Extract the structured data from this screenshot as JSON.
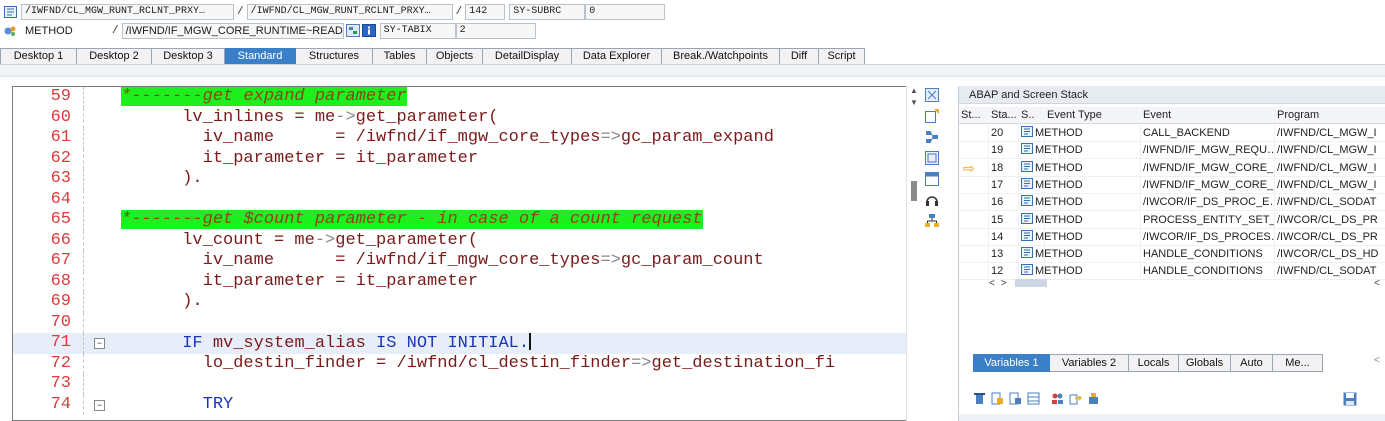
{
  "header": {
    "row1": {
      "icon": "program-icon",
      "main_program": "/IWFND/CL_MGW_RUNT_RCLNT_PRXY…",
      "include": "/IWFND/CL_MGW_RUNT_RCLNT_PRXY…",
      "line": "142",
      "sysvar_name": "SY-SUBRC",
      "sysvar_value": "0"
    },
    "row2": {
      "icon": "method-icon",
      "event_type": "METHOD",
      "event": "/IWFND/IF_MGW_CORE_RUNTIME~READ_ENTITYSET (…",
      "sysvar_name": "SY-TABIX",
      "sysvar_value": "2"
    }
  },
  "tabs": [
    "Desktop 1",
    "Desktop 2",
    "Desktop 3",
    "Standard",
    "Structures",
    "Tables",
    "Objects",
    "DetailDisplay",
    "Data Explorer",
    "Break./Watchpoints",
    "Diff",
    "Script"
  ],
  "active_tab": "Standard",
  "editor": {
    "lines": [
      {
        "n": "59",
        "a": "",
        "b": "*-------get expand parameter",
        "c": "",
        "kind": "comment"
      },
      {
        "n": "60",
        "a": "      lv_inlines = me",
        "b": "->",
        "c": "get_parameter(",
        "kind": "arrow"
      },
      {
        "n": "61",
        "a": "        iv_name      = /iwfnd/if_mgw_core_types",
        "b": "=>",
        "c": "gc_param_expand",
        "kind": "arrow"
      },
      {
        "n": "62",
        "a": "        it_parameter = it_parameter",
        "b": "",
        "c": "",
        "kind": "plain"
      },
      {
        "n": "63",
        "a": "      ).",
        "b": "",
        "c": "",
        "kind": "plain"
      },
      {
        "n": "64",
        "a": "",
        "b": "",
        "c": "",
        "kind": "plain"
      },
      {
        "n": "65",
        "a": "",
        "b": "*-------get $count parameter - in case of a count request",
        "c": "",
        "kind": "comment"
      },
      {
        "n": "66",
        "a": "      lv_count = me",
        "b": "->",
        "c": "get_parameter(",
        "kind": "arrow"
      },
      {
        "n": "67",
        "a": "        iv_name      = /iwfnd/if_mgw_core_types",
        "b": "=>",
        "c": "gc_param_count",
        "kind": "arrow"
      },
      {
        "n": "68",
        "a": "        it_parameter = it_parameter",
        "b": "",
        "c": "",
        "kind": "plain"
      },
      {
        "n": "69",
        "a": "      ).",
        "b": "",
        "c": "",
        "kind": "plain"
      },
      {
        "n": "70",
        "a": "",
        "b": "",
        "c": "",
        "kind": "plain"
      },
      {
        "n": "71",
        "a": "      IF ",
        "b": "mv_system_alias",
        "c": " IS NOT INITIAL.",
        "kind": "if"
      },
      {
        "n": "72",
        "a": "        lo_destin_finder = /iwfnd/cl_destin_finder",
        "b": "=>",
        "c": "get_destination_fi",
        "kind": "arrow"
      },
      {
        "n": "73",
        "a": "",
        "b": "",
        "c": "",
        "kind": "plain"
      },
      {
        "n": "74",
        "a": "        TRY",
        "b": "",
        "c": "",
        "kind": "kwline"
      }
    ],
    "current_line": "71",
    "fold_lines": [
      "71",
      "74"
    ]
  },
  "stack": {
    "title": "ABAP and Screen Stack",
    "columns": [
      "St...",
      "Sta...",
      "S..",
      "Event Type",
      "Event",
      "Program"
    ],
    "rows": [
      {
        "level": "20",
        "type": "METHOD",
        "event": "CALL_BACKEND",
        "program": "/IWFND/CL_MGW_I",
        "current": false
      },
      {
        "level": "19",
        "type": "METHOD",
        "event": "/IWFND/IF_MGW_REQU…",
        "program": "/IWFND/CL_MGW_I",
        "current": false
      },
      {
        "level": "18",
        "type": "METHOD",
        "event": "/IWFND/IF_MGW_CORE_…",
        "program": "/IWFND/CL_MGW_I",
        "current": true
      },
      {
        "level": "17",
        "type": "METHOD",
        "event": "/IWFND/IF_MGW_CORE_…",
        "program": "/IWFND/CL_MGW_I",
        "current": false
      },
      {
        "level": "16",
        "type": "METHOD",
        "event": "/IWCOR/IF_DS_PROC_E…",
        "program": "/IWFND/CL_SODAT",
        "current": false
      },
      {
        "level": "15",
        "type": "METHOD",
        "event": "PROCESS_ENTITY_SET_…",
        "program": "/IWCOR/CL_DS_PR",
        "current": false
      },
      {
        "level": "14",
        "type": "METHOD",
        "event": "/IWCOR/IF_DS_PROCES…",
        "program": "/IWCOR/CL_DS_PR",
        "current": false
      },
      {
        "level": "13",
        "type": "METHOD",
        "event": "HANDLE_CONDITIONS",
        "program": "/IWCOR/CL_DS_HD",
        "current": false
      },
      {
        "level": "12",
        "type": "METHOD",
        "event": "HANDLE_CONDITIONS",
        "program": "/IWFND/CL_SODAT",
        "current": false
      }
    ]
  },
  "variables": {
    "tabs": [
      "Variables 1",
      "Variables 2",
      "Locals",
      "Globals",
      "Auto",
      "Me..."
    ],
    "active_tab": "Variables 1"
  },
  "colors": {
    "active_tab": "#3a80c8",
    "comment_highlight": "#1ef01e",
    "line_number": "#e03a3a",
    "keyword": "#1c36b8",
    "identifier": "#7a1a1a",
    "current_arrow": "#f29a00"
  }
}
